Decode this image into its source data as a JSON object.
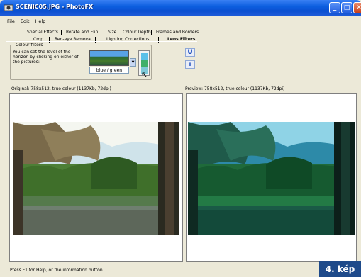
{
  "window": {
    "title": "SCENIC05.JPG - PhotoFX"
  },
  "menu": [
    "File",
    "Edit",
    "Help"
  ],
  "tabs_row1": [
    "Special Effects",
    "Rotate and Flip",
    "Size",
    "Colour Depth",
    "Frames and Borders"
  ],
  "tabs_row2": [
    "Crop",
    "Red-eye Removal",
    "Lighting Corrections",
    "Lens Filters"
  ],
  "filters": {
    "group_label": "Colour filters",
    "hint": "You can set the level of the horizon by clicking on either of the pictures:",
    "selected": "blue / green"
  },
  "buttons": {
    "undo": "U",
    "info": "i"
  },
  "original_info": "Original: 758x512, true colour (1137Kb, 72dpi)",
  "preview_info": "Preview: 758x512, true colour (1137Kb, 72dpi)",
  "status": "Press F1 for Help, or the information button",
  "badge": "4. kép",
  "colors": {
    "titlebar": "#0d5fe0",
    "badge": "#1e4a8a",
    "window_bg": "#ece9d8"
  }
}
